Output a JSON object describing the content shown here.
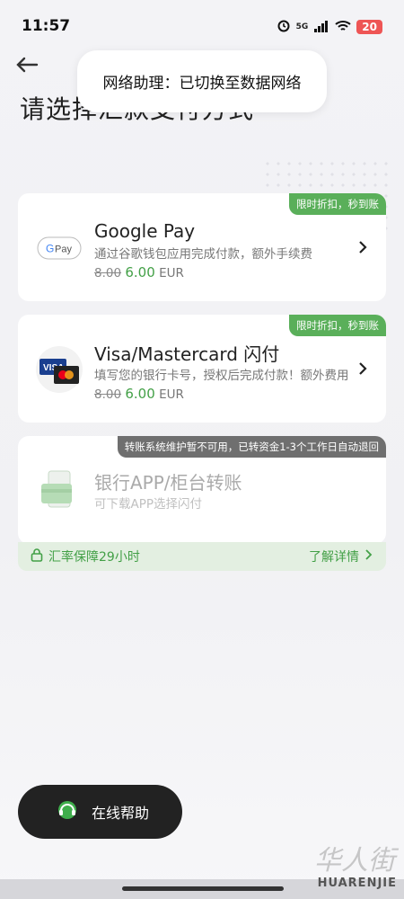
{
  "status": {
    "time": "11:57",
    "network": "5G",
    "battery": "20"
  },
  "toast": {
    "text": "网络助理：已切换至数据网络"
  },
  "page": {
    "title": "请选择汇款支付方式"
  },
  "methods": [
    {
      "badge": "限时折扣，秒到账",
      "title": "Google Pay",
      "desc": "通过谷歌钱包应用完成付款，额外手续费",
      "old_fee": "8.00",
      "new_fee": "6.00",
      "currency": "EUR",
      "icon": "gpay-logo-icon"
    },
    {
      "badge": "限时折扣，秒到账",
      "title": "Visa/Mastercard 闪付",
      "desc": "填写您的银行卡号，授权后完成付款！额外费用",
      "old_fee": "8.00",
      "new_fee": "6.00",
      "currency": "EUR",
      "icon": "visa-mastercard-icon"
    },
    {
      "badge": "转账系统维护暂不可用，已转资金1-3个工作日自动退回",
      "title": "银行APP/柜台转账",
      "desc": "可下载APP选择闪付",
      "icon": "bank-transfer-icon",
      "disabled": true
    }
  ],
  "rate_bar": {
    "left": "汇率保障29小时",
    "right": "了解详情"
  },
  "help": {
    "label": "在线帮助"
  },
  "watermark": {
    "cn": "华人街",
    "en": "HUARENJIE"
  },
  "colors": {
    "accent_green": "#43a047",
    "badge_green": "#5aaf5a",
    "badge_gray": "#6f6f6f"
  }
}
